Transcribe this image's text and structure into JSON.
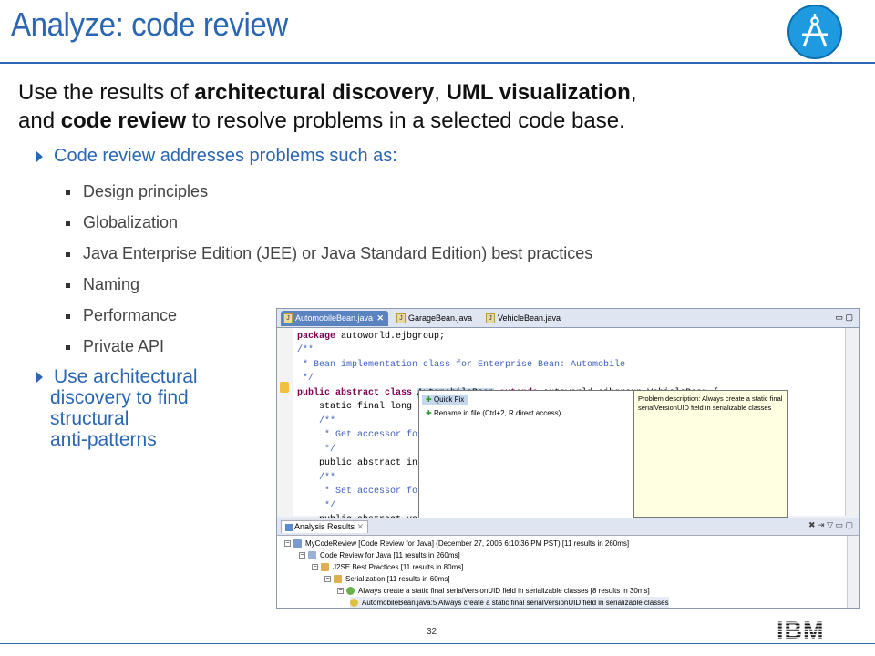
{
  "slide": {
    "title": "Analyze: code review",
    "intro": {
      "p1": "Use the results of ",
      "b1": "architectural discovery",
      "p2": ", ",
      "b2": "UML visualization",
      "p3": ",",
      "p4": "and ",
      "b3": "code review",
      "p5": " to resolve problems in a selected code base."
    },
    "bullet1": "Code review addresses problems such as:",
    "sub_items": [
      "Design principles",
      "Globalization",
      "Java Enterprise Edition (JEE) or Java Standard Edition) best practices",
      "Naming",
      "Performance",
      "Private API"
    ],
    "bullet2": [
      "Use architectural",
      "discovery to find",
      "structural",
      "anti-patterns"
    ],
    "page_number": "32",
    "logo": "IBM",
    "colors": {
      "accent": "#2a66b2",
      "logo_circle": "#1e9ae0"
    }
  },
  "ide": {
    "tabs": [
      "AutomobileBean.java",
      "GarageBean.java",
      "VehicleBean.java"
    ],
    "code": [
      "package autoworld.ejbgroup;",
      "/**",
      " * Bean implementation class for Enterprise Bean: Automobile",
      " */",
      "public abstract class AutomobileBean extends autoworld.ejbgroup.VehicleBean {",
      "    static final long",
      "    /**",
      "     * Get accessor fo",
      "     */",
      "    public abstract in",
      "    /**",
      "     * Set accessor fo",
      "     */",
      "    public abstract vo",
      "}"
    ],
    "quickfix": [
      "Quick Fix",
      "Rename in file (Ctrl+2, R direct access)"
    ],
    "problem_desc": "Problem description: Always create a static final serialVersionUID field in serializable classes",
    "results_tab": "Analysis Results",
    "tree": [
      "MyCodeReview [Code Review for Java]  (December 27, 2006 6:10:36 PM PST) [11 results in 260ms]",
      "Code Review for Java [11 results in 260ms]",
      "J2SE Best Practices [11 results in 80ms]",
      "Serialization [11 results in 60ms]",
      "Always create a static final serialVersionUID field in serializable classes [8 results in 30ms]",
      "AutomobileBean.java:5 Always create a static final serialVersionUID field in serializable classes"
    ]
  }
}
